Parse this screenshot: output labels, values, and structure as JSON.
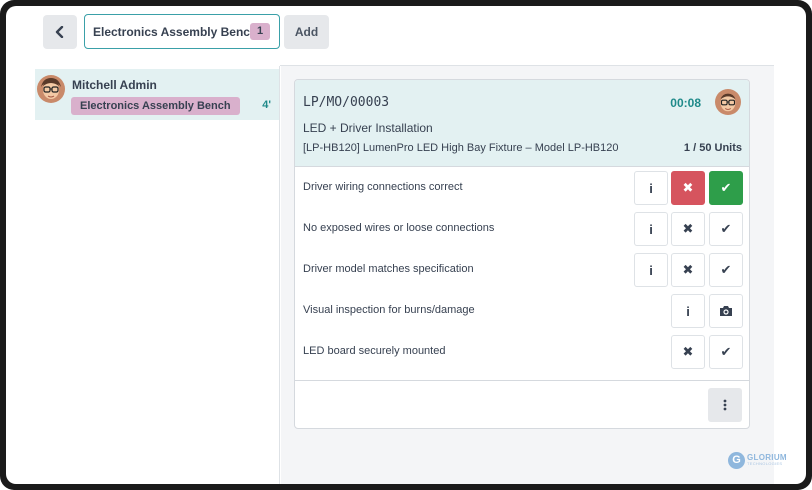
{
  "topbar": {
    "back_icon": "chevron-left-icon",
    "workcenter_tab": {
      "label": "Electronics Assembly Bench",
      "count": "1"
    },
    "add_label": "Add"
  },
  "employee_panel": {
    "employees": [
      {
        "name": "Mitchell Admin",
        "workcenter": "Electronics Assembly Bench",
        "time": "4'",
        "avatar_icon": "employee-avatar-icon"
      }
    ]
  },
  "workorder": {
    "mo_name": "LP/MO/00003",
    "timer": "00:08",
    "operation": "LED + Driver Installation",
    "product": "[LP-HB120] LumenPro LED High Bay Fixture – Model LP-HB120",
    "quantity": "1 / 50 Units",
    "checks": [
      {
        "label": "Driver wiring connections correct",
        "buttons": [
          "info",
          "fail",
          "pass"
        ],
        "state": "both-active"
      },
      {
        "label": "No exposed wires or loose connections",
        "buttons": [
          "info",
          "fail",
          "pass"
        ],
        "state": "none"
      },
      {
        "label": "Driver model matches specification",
        "buttons": [
          "info",
          "fail",
          "pass"
        ],
        "state": "none"
      },
      {
        "label": "Visual inspection for burns/damage",
        "buttons": [
          "info",
          "camera"
        ],
        "state": "none"
      },
      {
        "label": "LED board securely mounted",
        "buttons": [
          "fail",
          "pass"
        ],
        "state": "none"
      }
    ],
    "more_icon": "ellipsis-vertical-icon"
  },
  "watermark": {
    "name": "GLORIUM",
    "tagline": "TECHNOLOGIES"
  },
  "colors": {
    "accent": "#1f8a8a",
    "badge": "#d9b0cc",
    "fail": "#d6545e",
    "pass": "#2e9e4a",
    "highlight": "#e3f1f2"
  }
}
